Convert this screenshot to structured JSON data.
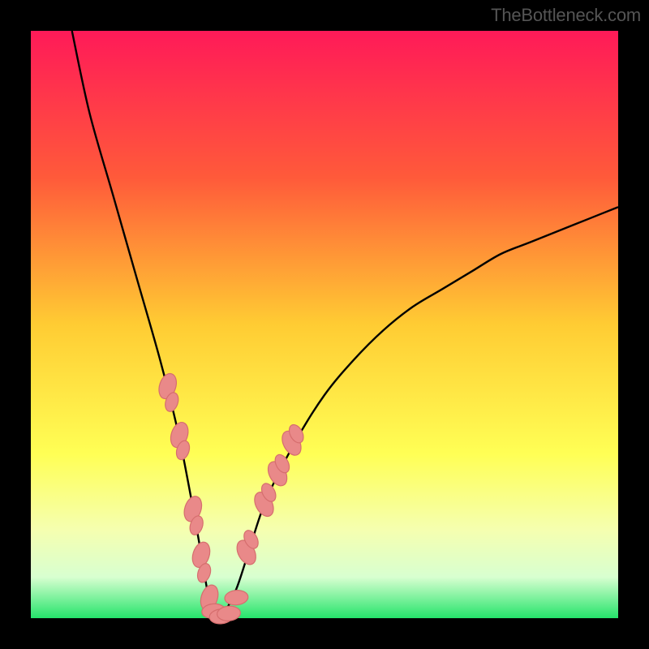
{
  "watermark": "TheBottleneck.com",
  "chart_data": {
    "type": "line",
    "title": "",
    "xlabel": "",
    "ylabel": "",
    "xlim": [
      0,
      100
    ],
    "ylim": [
      0,
      100
    ],
    "series": [
      {
        "name": "curve",
        "x": [
          7,
          10,
          14,
          18,
          22,
          25,
          27,
          29,
          30,
          31,
          32,
          33,
          35,
          37,
          40,
          45,
          50,
          55,
          60,
          65,
          70,
          75,
          80,
          85,
          90,
          95,
          100
        ],
        "y": [
          100,
          86,
          72,
          58,
          44,
          32,
          22,
          11,
          5,
          1,
          0,
          1,
          5,
          11,
          20,
          30,
          38,
          44,
          49,
          53,
          56,
          59,
          62,
          64,
          66,
          68,
          70
        ]
      }
    ],
    "gradient_stops": [
      {
        "offset": 0,
        "color": "#ff1a58"
      },
      {
        "offset": 25,
        "color": "#ff5a3a"
      },
      {
        "offset": 50,
        "color": "#ffcc33"
      },
      {
        "offset": 72,
        "color": "#ffff55"
      },
      {
        "offset": 85,
        "color": "#f5ffb0"
      },
      {
        "offset": 93,
        "color": "#d8ffd0"
      },
      {
        "offset": 100,
        "color": "#25e46b"
      }
    ],
    "markers": {
      "color": "#e98989",
      "stroke": "#d66e6e",
      "left_branch": [
        {
          "x": 23.3,
          "y": 39.5
        },
        {
          "x": 24.0,
          "y": 36.8
        },
        {
          "x": 25.3,
          "y": 31.2
        },
        {
          "x": 25.9,
          "y": 28.6
        },
        {
          "x": 27.6,
          "y": 18.6
        },
        {
          "x": 28.2,
          "y": 15.8
        },
        {
          "x": 29.0,
          "y": 10.8
        },
        {
          "x": 29.5,
          "y": 7.7
        },
        {
          "x": 30.4,
          "y": 3.5
        }
      ],
      "right_branch": [
        {
          "x": 36.7,
          "y": 11.2
        },
        {
          "x": 37.5,
          "y": 13.4
        },
        {
          "x": 39.7,
          "y": 19.4
        },
        {
          "x": 40.5,
          "y": 21.4
        },
        {
          "x": 42.0,
          "y": 24.6
        },
        {
          "x": 42.8,
          "y": 26.3
        },
        {
          "x": 44.4,
          "y": 29.8
        },
        {
          "x": 45.2,
          "y": 31.4
        }
      ],
      "bottom": [
        {
          "x": 31.1,
          "y": 1.2
        },
        {
          "x": 32.4,
          "y": 0.3
        },
        {
          "x": 33.7,
          "y": 0.8
        },
        {
          "x": 35.0,
          "y": 3.5
        }
      ]
    }
  }
}
